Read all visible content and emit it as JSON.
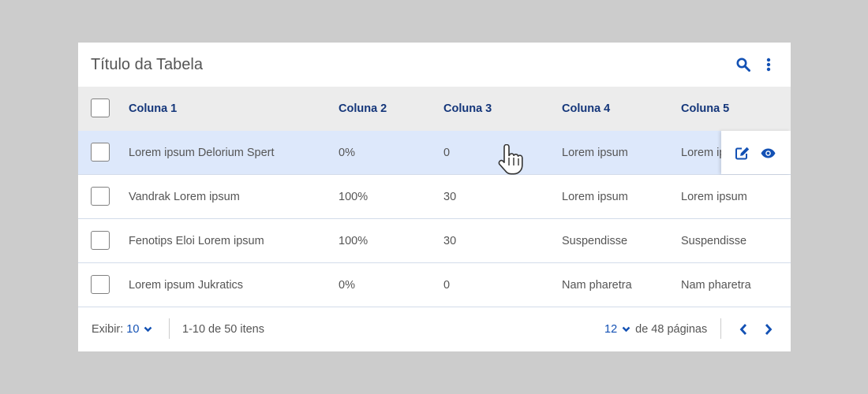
{
  "table": {
    "title": "Título da Tabela",
    "columns": [
      "Coluna 1",
      "Coluna 2",
      "Coluna 3",
      "Coluna 4",
      "Coluna 5"
    ],
    "rows": [
      [
        "Lorem ipsum Delorium Spert",
        "0%",
        "0",
        "Lorem ipsum",
        "Lorem ipsum"
      ],
      [
        "Vandrak Lorem ipsum",
        "100%",
        "30",
        "Lorem ipsum",
        "Lorem ipsum"
      ],
      [
        "Fenotips Eloi Lorem ipsum",
        "100%",
        "30",
        "Suspendisse",
        "Suspendisse"
      ],
      [
        "Lorem ipsum Jukratics",
        "0%",
        "0",
        "Nam pharetra",
        "Nam pharetra"
      ]
    ],
    "hovered_row": 0
  },
  "footer": {
    "show_label": "Exibir:",
    "show_value": "10",
    "range_text": "1-10 de 50 itens",
    "page_value": "12",
    "pages_text": "de 48 páginas"
  },
  "icons": {
    "search": "search-icon",
    "more": "more-vertical-icon",
    "edit": "edit-icon",
    "view": "eye-icon",
    "prev": "chevron-left-icon",
    "next": "chevron-right-icon",
    "cursor": "hand-pointer-cursor"
  },
  "colors": {
    "accent": "#1351b4",
    "header_text": "#14367a",
    "hover_row": "#dde8fb",
    "background": "#cccccc"
  }
}
